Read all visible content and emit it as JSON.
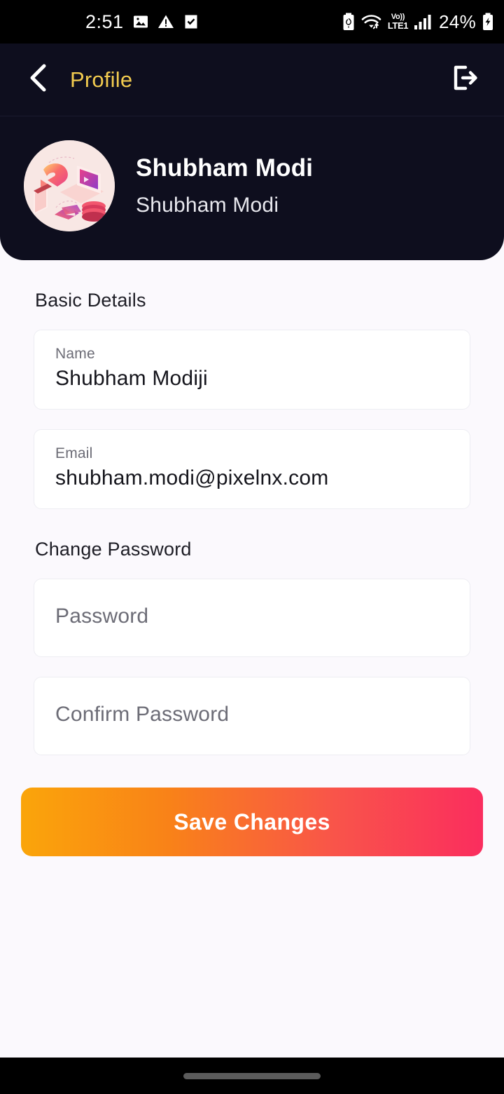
{
  "status_bar": {
    "time": "2:51",
    "battery_percent": "24%",
    "network_label_top": "Vo))",
    "network_label_bottom": "LTE1",
    "left_icons": [
      "image-icon",
      "warning-triangle-icon",
      "task-checkbox-icon"
    ],
    "right_icons": [
      "battery-saver-icon",
      "wifi-icon",
      "volte-icon",
      "signal-bars-icon",
      "battery-charging-icon"
    ]
  },
  "app_bar": {
    "back_icon": "chevron-left-icon",
    "title": "Profile",
    "logout_icon": "logout-icon",
    "title_color": "#F2CB4F",
    "background_color": "#0E0E1E"
  },
  "profile": {
    "avatar_icon": "avatar-illustration",
    "name": "Shubham Modi",
    "subtitle": "Shubham Modi"
  },
  "basic_details": {
    "section_title": "Basic Details",
    "fields": [
      {
        "label": "Name",
        "value": "Shubham Modiji"
      },
      {
        "label": "Email",
        "value": "shubham.modi@pixelnx.com"
      }
    ]
  },
  "change_password": {
    "section_title": "Change Password",
    "fields": [
      {
        "placeholder": "Password",
        "value": ""
      },
      {
        "placeholder": "Confirm Password",
        "value": ""
      }
    ]
  },
  "actions": {
    "save_label": "Save Changes",
    "gradient_start": "#FAA50A",
    "gradient_end": "#FA2D5E"
  },
  "nav_bar": {
    "home_indicator": "home-indicator"
  }
}
